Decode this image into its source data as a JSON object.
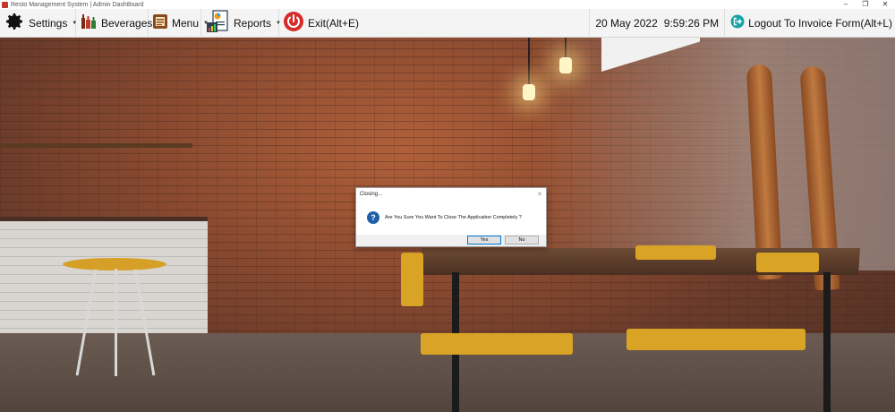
{
  "window": {
    "title": "Resto Management System  |  Admin DashBoard",
    "controls": [
      "–",
      "❐",
      "✕"
    ]
  },
  "menubar": {
    "items": [
      {
        "label": "Settings",
        "icon": "gear-icon",
        "has_dropdown": true
      },
      {
        "label": "Beverages",
        "icon": "beverages-icon",
        "has_dropdown": true
      },
      {
        "label": "Menu",
        "icon": "menu-book-icon",
        "has_dropdown": true
      },
      {
        "label": "Reports",
        "icon": "reports-icon",
        "has_dropdown": true
      },
      {
        "label": "Exit(Alt+E)",
        "icon": "power-icon",
        "has_dropdown": false
      }
    ],
    "date": "20 May 2022",
    "time": "9:59:26 PM",
    "logout_label": "Logout To Invoice Form(Alt+L)",
    "logout_icon": "logout-icon"
  },
  "dialog": {
    "title": "Closing...",
    "message": "Are You Sure You Want To Close The Application Completely ?",
    "icon": "question-icon",
    "yes_label": "Yes",
    "no_label": "No"
  },
  "colors": {
    "menubar_bg": "#f4f4f4",
    "exit_red": "#d62b2b",
    "logout_teal": "#1aa3a3",
    "question_blue": "#1f5fa8",
    "default_button_border": "#0078d7"
  }
}
